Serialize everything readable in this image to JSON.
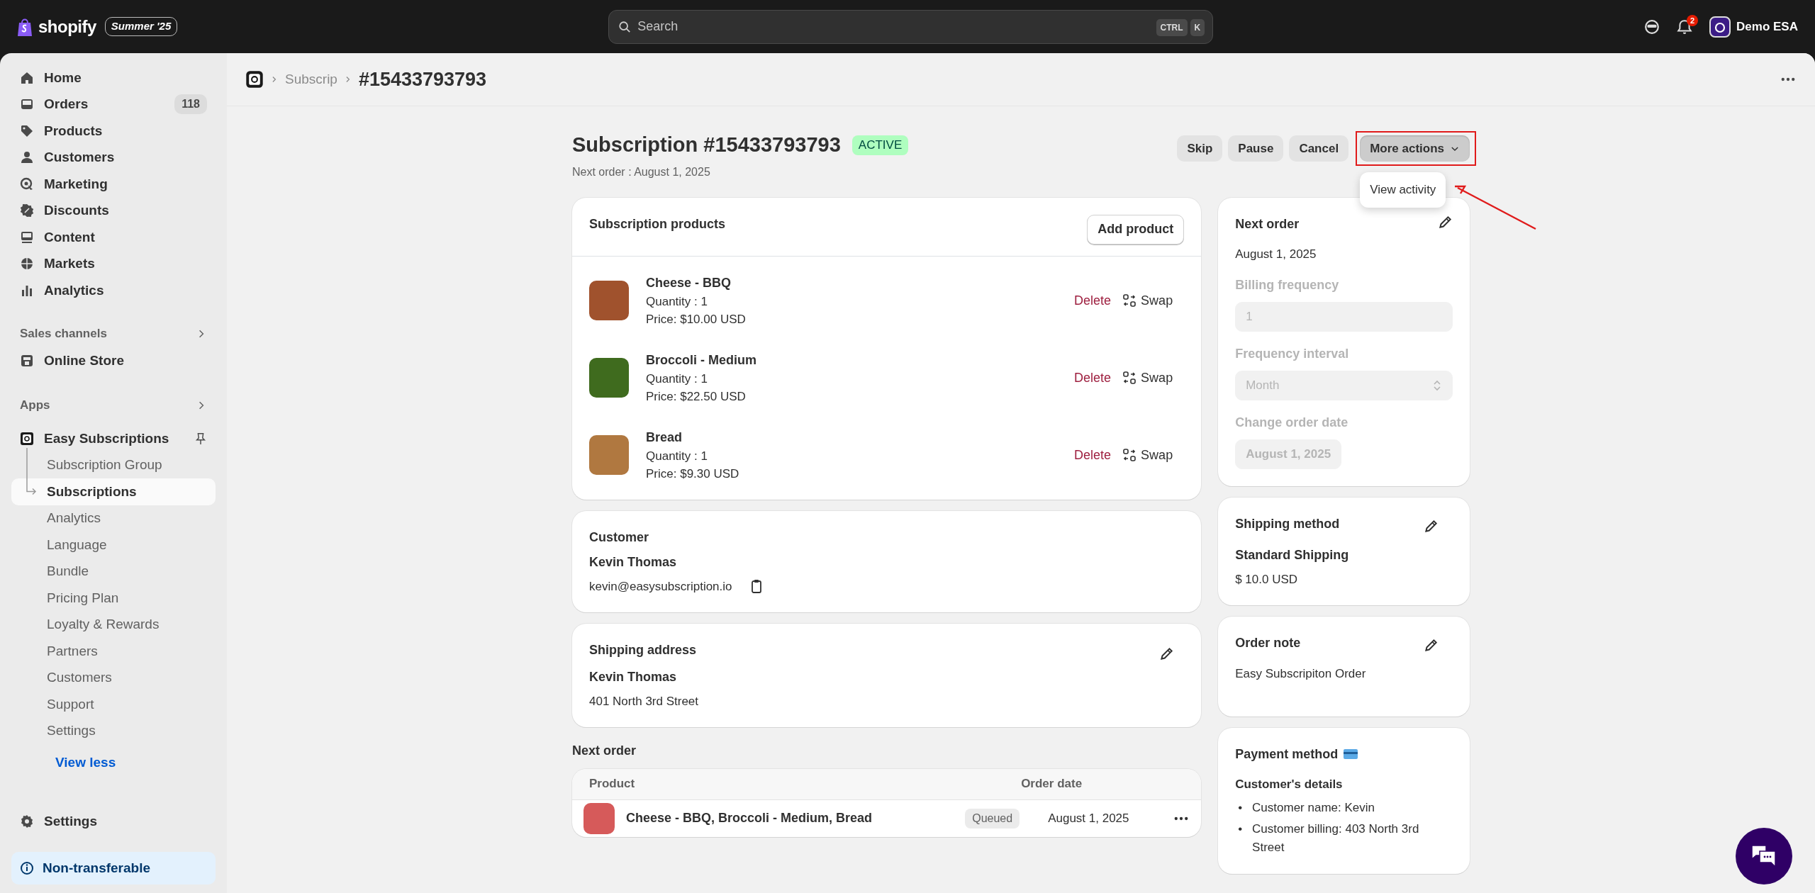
{
  "topbar": {
    "brand": "shopify",
    "edition": "Summer '25",
    "search": {
      "placeholder": "Search",
      "shortcut": [
        "CTRL",
        "K"
      ]
    },
    "notifications": "2",
    "store": "Demo ESA"
  },
  "sidebar": {
    "items": [
      {
        "label": "Home",
        "selected": false
      },
      {
        "label": "Orders",
        "badge": "118",
        "selected": false
      },
      {
        "label": "Products",
        "selected": false
      },
      {
        "label": "Customers",
        "selected": false
      },
      {
        "label": "Marketing",
        "selected": false
      },
      {
        "label": "Discounts",
        "selected": false
      },
      {
        "label": "Content",
        "selected": false
      },
      {
        "label": "Markets",
        "selected": false
      },
      {
        "label": "Analytics",
        "selected": false
      }
    ],
    "sales_channels": {
      "title": "Sales channels",
      "items": [
        {
          "label": "Online Store",
          "selected": false
        }
      ]
    },
    "apps": {
      "title": "Apps",
      "app": "Easy Subscriptions",
      "items": [
        {
          "label": "Subscription Group",
          "selected": false
        },
        {
          "label": "Subscriptions",
          "selected": true
        },
        {
          "label": "Analytics",
          "selected": false
        },
        {
          "label": "Language",
          "selected": false
        },
        {
          "label": "Bundle",
          "selected": false
        },
        {
          "label": "Pricing Plan",
          "selected": false
        },
        {
          "label": "Loyalty & Rewards",
          "selected": false
        },
        {
          "label": "Partners",
          "selected": false
        },
        {
          "label": "Customers",
          "selected": false
        },
        {
          "label": "Support",
          "selected": false
        },
        {
          "label": "Settings",
          "selected": false
        }
      ],
      "toggle": "View less"
    },
    "footer_items": [
      {
        "label": "Settings",
        "selected": false
      }
    ],
    "notice": "Non-transferable"
  },
  "breadcrumb": {
    "parent": "Subscrip",
    "current": "#15433793793"
  },
  "header": {
    "title": "Subscription #15433793793",
    "status": "ACTIVE",
    "subtitle": "Next order : August 1, 2025",
    "actions": [
      "Skip",
      "Pause",
      "Cancel"
    ],
    "more_actions": {
      "label": "More actions",
      "expanded": true,
      "menu": [
        "View activity"
      ]
    }
  },
  "products_card": {
    "title": "Subscription products",
    "add_button": "Add product",
    "products": [
      {
        "name": "Cheese - BBQ",
        "quantity": "Quantity : 1",
        "price": "Price: $10.00 USD",
        "delete": "Delete",
        "swap": "Swap"
      },
      {
        "name": "Broccoli - Medium",
        "quantity": "Quantity : 1",
        "price": "Price: $22.50 USD",
        "delete": "Delete",
        "swap": "Swap"
      },
      {
        "name": "Bread",
        "quantity": "Quantity : 1",
        "price": "Price: $9.30 USD",
        "delete": "Delete",
        "swap": "Swap"
      }
    ]
  },
  "customer_card": {
    "title": "Customer",
    "name": "Kevin Thomas",
    "email": "kevin@easysubscription.io"
  },
  "shipping_address": {
    "title": "Shipping address",
    "name": "Kevin Thomas",
    "address": "401 North 3rd Street"
  },
  "next_order_section": {
    "title": "Next order",
    "table": {
      "columns": [
        "Product",
        "Order date"
      ],
      "rows": [
        {
          "product": "Cheese - BBQ,  Broccoli - Medium,  Bread",
          "status": "Queued",
          "date": "August 1, 2025"
        }
      ]
    }
  },
  "next_order_card": {
    "title": "Next order",
    "date": "August 1, 2025",
    "fields": [
      {
        "kind": "input",
        "label": "Billing frequency",
        "value": "1",
        "disabled": true
      },
      {
        "kind": "select",
        "label": "Frequency interval",
        "value": "Month",
        "disabled": true
      },
      {
        "kind": "date",
        "label": "Change order date",
        "value": "August 1, 2025",
        "disabled": true
      }
    ]
  },
  "shipping_method": {
    "title": "Shipping method",
    "name": "Standard Shipping",
    "price": "$ 10.0 USD"
  },
  "order_note": {
    "title": "Order note",
    "text": "Easy Subscripiton Order"
  },
  "payment_method": {
    "title": "Payment method",
    "subtitle": "Customer's details",
    "bullet": "•",
    "details": [
      "Customer name: Kevin",
      "Customer billing: 403 North 3rd Street"
    ]
  }
}
